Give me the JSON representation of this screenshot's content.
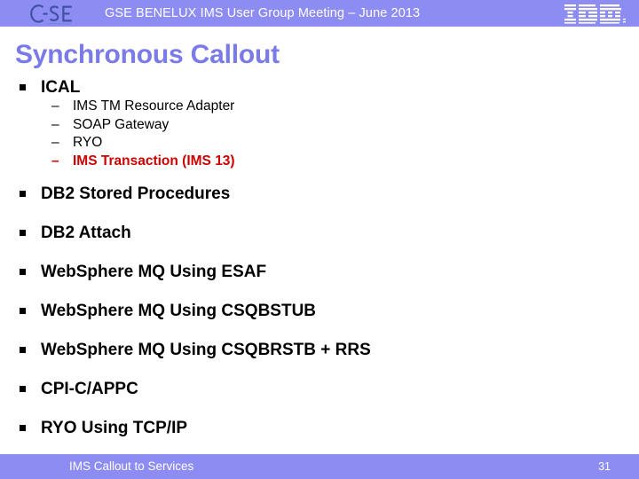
{
  "header": {
    "title": "GSE BENELUX IMS User Group Meeting – June 2013",
    "band_color": "#8c8cf2",
    "left_logo_name": "GSE",
    "right_logo_name": "IBM"
  },
  "slide": {
    "title": "Synchronous Callout",
    "title_color": "#7a7ae8",
    "highlight_color": "#cc0000",
    "bullets": [
      {
        "label": "ICAL",
        "sub_items": [
          {
            "label": "IMS TM Resource Adapter",
            "highlight": false
          },
          {
            "label": "SOAP Gateway",
            "highlight": false
          },
          {
            "label": "RYO",
            "highlight": false
          },
          {
            "label": "IMS Transaction (IMS 13)",
            "highlight": true
          }
        ]
      },
      {
        "label": "DB2 Stored Procedures",
        "sub_items": []
      },
      {
        "label": "DB2 Attach",
        "sub_items": []
      },
      {
        "label": "WebSphere MQ Using ESAF",
        "sub_items": []
      },
      {
        "label": "WebSphere MQ Using CSQBSTUB",
        "sub_items": []
      },
      {
        "label": "WebSphere MQ Using CSQBRSTB + RRS",
        "sub_items": []
      },
      {
        "label": "CPI-C/APPC",
        "sub_items": []
      },
      {
        "label": "RYO Using TCP/IP",
        "sub_items": []
      }
    ]
  },
  "footer": {
    "text": "IMS Callout to Services",
    "page_number": "31",
    "band_color": "#8c8cf2"
  },
  "marks": {
    "level1_bullet": "square-bullet",
    "level2_bullet": "–"
  }
}
